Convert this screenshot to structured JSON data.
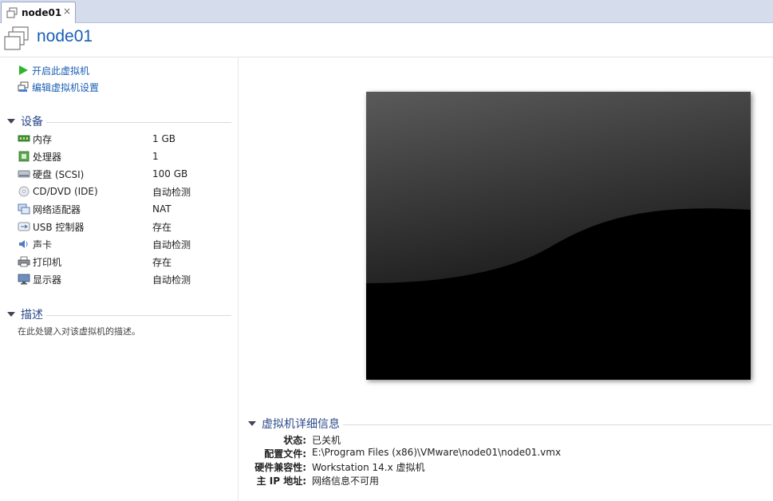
{
  "tab": {
    "label": "node01",
    "close": "×"
  },
  "header": {
    "title": "node01"
  },
  "actions": [
    {
      "label": "开启此虚拟机",
      "icon": "play-icon"
    },
    {
      "label": "编辑虚拟机设置",
      "icon": "settings-icon"
    }
  ],
  "devices": {
    "title": "设备",
    "items": [
      {
        "name": "内存",
        "value": "1 GB",
        "icon": "memory-icon"
      },
      {
        "name": "处理器",
        "value": "1",
        "icon": "processor-icon"
      },
      {
        "name": "硬盘 (SCSI)",
        "value": "100 GB",
        "icon": "hard-disk-icon"
      },
      {
        "name": "CD/DVD (IDE)",
        "value": "自动检测",
        "icon": "cd-dvd-icon"
      },
      {
        "name": "网络适配器",
        "value": "NAT",
        "icon": "network-adapter-icon"
      },
      {
        "name": "USB 控制器",
        "value": "存在",
        "icon": "usb-icon"
      },
      {
        "name": "声卡",
        "value": "自动检测",
        "icon": "sound-card-icon"
      },
      {
        "name": "打印机",
        "value": "存在",
        "icon": "printer-icon"
      },
      {
        "name": "显示器",
        "value": "自动检测",
        "icon": "display-icon"
      }
    ]
  },
  "description": {
    "title": "描述",
    "placeholder": "在此处键入对该虚拟机的描述。"
  },
  "details": {
    "title": "虚拟机详细信息",
    "rows": [
      {
        "label": "状态:",
        "value": "已关机"
      },
      {
        "label": "配置文件:",
        "value": "E:\\Program Files (x86)\\VMware\\node01\\node01.vmx"
      },
      {
        "label": "硬件兼容性:",
        "value": "Workstation 14.x 虚拟机"
      },
      {
        "label": "主 IP 地址:",
        "value": "网络信息不可用"
      }
    ]
  },
  "colors": {
    "link": "#1a5fb4",
    "section_title": "#2b4a8a",
    "tab_bar": "#d5dcec"
  }
}
